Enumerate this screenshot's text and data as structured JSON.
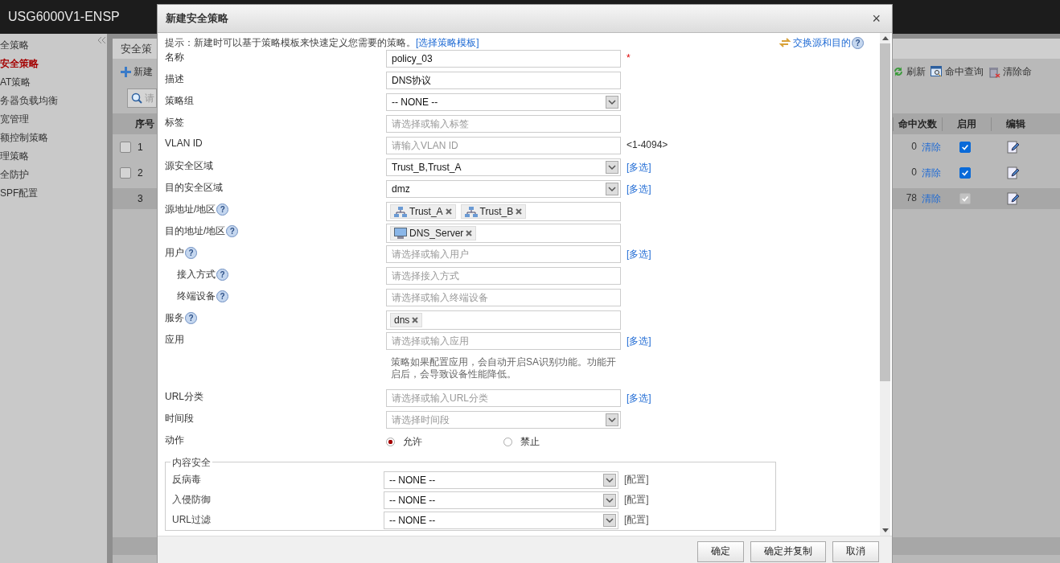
{
  "header": {
    "title": "USG6000V1-ENSP"
  },
  "sidebar": {
    "items": [
      {
        "label": "全策略",
        "selected": false
      },
      {
        "label": "安全策略",
        "selected": true
      },
      {
        "label": "AT策略",
        "selected": false
      },
      {
        "label": "务器负载均衡",
        "selected": false
      },
      {
        "label": "宽管理",
        "selected": false
      },
      {
        "label": "额控制策略",
        "selected": false
      },
      {
        "label": "理策略",
        "selected": false
      },
      {
        "label": "全防护",
        "selected": false
      },
      {
        "label": "SPF配置",
        "selected": false
      }
    ]
  },
  "panel": {
    "title": "安全策",
    "new_button": "新建",
    "search_placeholder": "请",
    "toolbar": [
      {
        "kind": "refresh",
        "label": "刷新"
      },
      {
        "kind": "query",
        "label": "命中查询"
      },
      {
        "kind": "clear",
        "label": "清除命"
      }
    ],
    "columns_left": [
      "序号"
    ],
    "columns_right": [
      "命中次数",
      "启用",
      "编辑"
    ],
    "rows": [
      {
        "index": "1",
        "selectable": true,
        "checked": false,
        "hits": "0",
        "clear": "清除",
        "enabled": true,
        "disabled": false
      },
      {
        "index": "2",
        "selectable": true,
        "checked": false,
        "hits": "0",
        "clear": "清除",
        "enabled": true,
        "disabled": false
      },
      {
        "index": "3",
        "selectable": false,
        "hits": "78",
        "clear": "清除",
        "enabled": true,
        "disabled": true
      }
    ]
  },
  "dialog": {
    "title": "新建安全策略",
    "close": "×",
    "hint": "提示：新建时可以基于策略模板来快速定义您需要的策略。",
    "template_link": "[选择策略模板]",
    "swap_link": "交换源和目的",
    "swap_help": "?",
    "fields": [
      {
        "kind": "text",
        "label": "名称",
        "value": "policy_03",
        "required": "*"
      },
      {
        "kind": "text",
        "label": "描述",
        "value": "DNS协议"
      },
      {
        "kind": "select",
        "label": "策略组",
        "value": "-- NONE --"
      },
      {
        "kind": "text",
        "label": "标签",
        "placeholder": "请选择或输入标签"
      },
      {
        "kind": "text",
        "label": "VLAN ID",
        "placeholder": "请输入VLAN ID",
        "note": "<1-4094>"
      },
      {
        "kind": "select",
        "label": "源安全区域",
        "value": "Trust_B,Trust_A",
        "link": "[多选]"
      },
      {
        "kind": "select",
        "label": "目的安全区域",
        "value": "dmz",
        "link": "[多选]"
      },
      {
        "kind": "tags",
        "label": "源地址/地区",
        "help": "?",
        "tags": [
          {
            "kind": "group",
            "label": "Trust_A"
          },
          {
            "kind": "group",
            "label": "Trust_B"
          }
        ]
      },
      {
        "kind": "tags",
        "label": "目的地址/地区",
        "help": "?",
        "tags": [
          {
            "kind": "host",
            "label": "DNS_Server"
          }
        ]
      },
      {
        "kind": "text",
        "label": "用户",
        "help": "?",
        "placeholder": "请选择或输入用户",
        "link": "[多选]",
        "children": [
          {
            "kind": "text",
            "label": "接入方式",
            "help": "?",
            "placeholder": "请选择接入方式"
          },
          {
            "kind": "text",
            "label": "终端设备",
            "help": "?",
            "placeholder": "请选择或输入终端设备"
          }
        ]
      },
      {
        "kind": "tags",
        "label": "服务",
        "help": "?",
        "tags": [
          {
            "kind": "plain",
            "label": "dns"
          }
        ]
      },
      {
        "kind": "text",
        "label": "应用",
        "placeholder": "请选择或输入应用",
        "link": "[多选]",
        "info": "策略如果配置应用，会自动开启SA识别功能。功能开启后，会导致设备性能降低。"
      },
      {
        "kind": "text",
        "label": "URL分类",
        "placeholder": "请选择或输入URL分类",
        "link": "[多选]"
      },
      {
        "kind": "select",
        "label": "时间段",
        "placeholder": "请选择时间段"
      },
      {
        "kind": "radio",
        "label": "动作",
        "options": [
          {
            "label": "允许",
            "selected": true
          },
          {
            "label": "禁止",
            "selected": false
          }
        ]
      }
    ],
    "content_security": {
      "legend": "内容安全",
      "rows": [
        {
          "label": "反病毒",
          "value": "-- NONE --",
          "link": "[配置]"
        },
        {
          "label": "入侵防御",
          "value": "-- NONE --",
          "link": "[配置]"
        },
        {
          "label": "URL过滤",
          "value": "-- NONE --",
          "link": "[配置]"
        }
      ]
    },
    "buttons": [
      "确定",
      "确定并复制",
      "取消"
    ]
  }
}
